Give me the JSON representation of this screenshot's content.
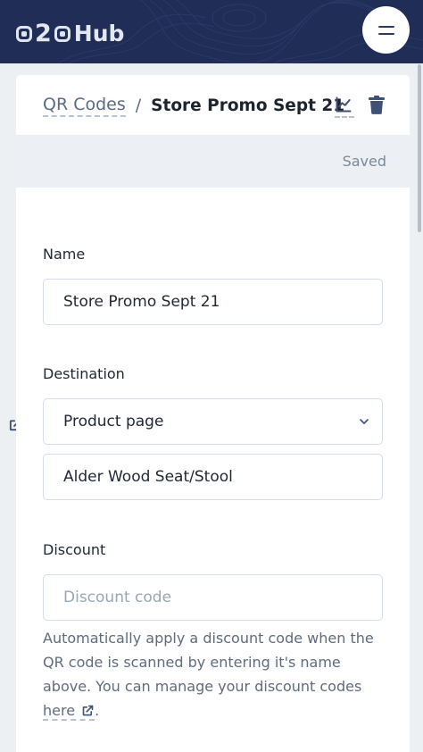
{
  "header": {
    "logo_text": "o2oHub",
    "logo_two": "2",
    "logo_hub": "Hub",
    "menu_icon": "hamburger-icon"
  },
  "breadcrumb": {
    "parent_label": "QR Codes",
    "separator": "/",
    "current_label": "Store Promo Sept 21"
  },
  "actions": {
    "analytics_icon": "chart-line-icon",
    "delete_icon": "trash-icon"
  },
  "status": {
    "text": "Saved"
  },
  "form": {
    "name": {
      "label": "Name",
      "value": "Store Promo Sept 21"
    },
    "destination": {
      "label": "Destination",
      "selected": "Product page",
      "product_value": "Alder Wood Seat/Stool",
      "external_icon": "external-link-icon"
    },
    "discount": {
      "label": "Discount",
      "placeholder": "Discount code",
      "help_text": "Automatically apply a discount code when the QR code is scanned by entering it's name above. You can manage your discount codes",
      "help_link": "here",
      "help_end": "."
    }
  },
  "colors": {
    "nav_background": "#1f2d57",
    "page_background": "#edf0f3",
    "status_band": "#ecf0f4",
    "muted_text": "#5e6c7e"
  }
}
